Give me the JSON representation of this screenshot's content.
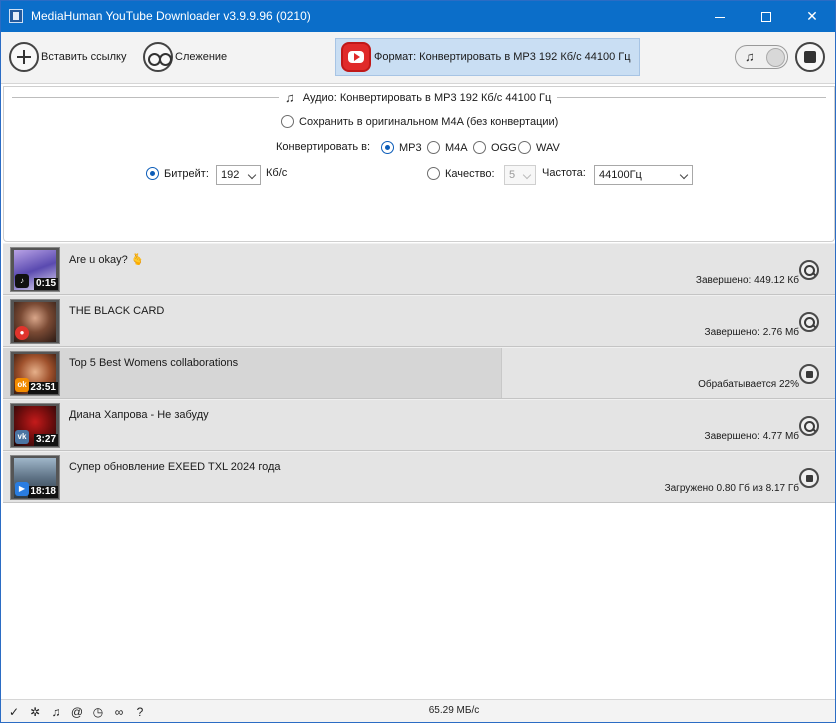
{
  "window": {
    "title": "MediaHuman YouTube Downloader v3.9.9.96 (0210)",
    "minimize_glyph": "",
    "maximize_glyph": "",
    "close_glyph": "✕"
  },
  "toolbar": {
    "paste_label": "Вставить ссылку",
    "tracking_label": "Слежение",
    "format_label": "Формат: Конвертировать в MP3 192 Кб/с 44100 Гц"
  },
  "settings": {
    "group_title": "Аудио: Конвертировать в MP3 192 Кб/с 44100 Гц",
    "keep_original_label": "Сохранить в оригинальном M4A (без конвертации)",
    "convert_to_label": "Конвертировать в:",
    "formats": [
      "MP3",
      "M4A",
      "OGG",
      "WAV"
    ],
    "selected_format": "MP3",
    "bitrate_label": "Битрейт:",
    "bitrate_value": "192",
    "bitrate_unit": "Кб/с",
    "quality_label": "Качество:",
    "quality_value": "5",
    "frequency_label": "Частота:",
    "frequency_value": "44100Гц"
  },
  "downloads": [
    {
      "title": "Are u okay? 🫰",
      "status": "Завершено: 449.12 Кб",
      "duration": "0:15",
      "source": "tiktok",
      "action": "search-icon",
      "progress": 1.0
    },
    {
      "title": "THE BLACK CARD",
      "status": "Завершено: 2.76 Мб",
      "duration": "",
      "source": "other",
      "action": "search-icon",
      "progress": 1.0
    },
    {
      "title": "Top 5 Best Womens collaborations",
      "status": "Обрабатывается 22%",
      "duration": "23:51",
      "source": "ok",
      "action": "stop-icon",
      "progress": 0.6
    },
    {
      "title": "Диана Хапрова - Не забуду",
      "status": "Завершено: 4.77 Мб",
      "duration": "3:27",
      "source": "vk",
      "action": "search-icon",
      "progress": 1.0
    },
    {
      "title": "Супер обновление EXEED TXL 2024 года",
      "status": "Загружено 0.80 Гб из 8.17 Гб",
      "duration": "18:18",
      "source": "rutube",
      "action": "stop-icon",
      "progress": 1.0
    }
  ],
  "statusbar": {
    "speed": "65.29 МБ/с",
    "icons": [
      "cleanup-icon",
      "settings-gear-icon",
      "music-icon",
      "snail-speed-icon",
      "clock-icon",
      "binoculars-icon",
      "help-icon"
    ]
  },
  "colors": {
    "titlebar": "#0b6ec9",
    "format_button": "#c9def3",
    "radio_selected": "#0b5cb8",
    "youtube_red": "#e02a2a"
  }
}
